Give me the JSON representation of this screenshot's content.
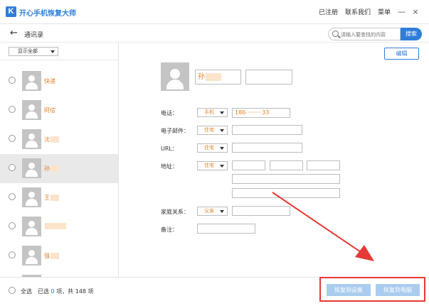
{
  "app": {
    "logo_letter": "K",
    "title": "开心手机恢复大师"
  },
  "top_links": {
    "registered": "已注册",
    "contact": "联系我们",
    "menu": "菜单"
  },
  "window_controls": {
    "minimize": "—",
    "close": "×"
  },
  "header": {
    "back_icon": "arrow-left-icon",
    "title": "通讯录"
  },
  "search": {
    "placeholder": "请输入要查找的内容",
    "button": "搜索"
  },
  "filter": {
    "value": "显示全部"
  },
  "contacts": [
    {
      "name": "快递",
      "selected": false
    },
    {
      "name": "阿信",
      "selected": false
    },
    {
      "name": "沈",
      "selected": false
    },
    {
      "name": "孙",
      "selected": true
    },
    {
      "name": "王",
      "selected": false
    },
    {
      "name": "",
      "selected": false
    },
    {
      "name": "强",
      "selected": false
    }
  ],
  "detail": {
    "edit": "编辑",
    "surname": "孙",
    "given_name": "",
    "phone_label": "电话：",
    "phone_type": "手机",
    "phone_value": "186·········33",
    "email_label": "电子邮件：",
    "email_type": "住宅",
    "url_label": "URL：",
    "url_type": "住宅",
    "address_label": "地址：",
    "address_type": "住宅",
    "family_label": "家庭关系：",
    "family_type": "父亲",
    "note_label": "备注："
  },
  "bottom": {
    "select_all": "全选",
    "selected_prefix": "已选",
    "selected_count": "0",
    "selected_suffix": "项，共 148 项",
    "restore_device": "恢复到设备",
    "restore_pc": "恢复到电脑"
  },
  "colors": {
    "accent": "#2f7ed8",
    "name_text": "#e67e22",
    "annotation": "#e53935",
    "restore_button": "#a9ccef"
  }
}
